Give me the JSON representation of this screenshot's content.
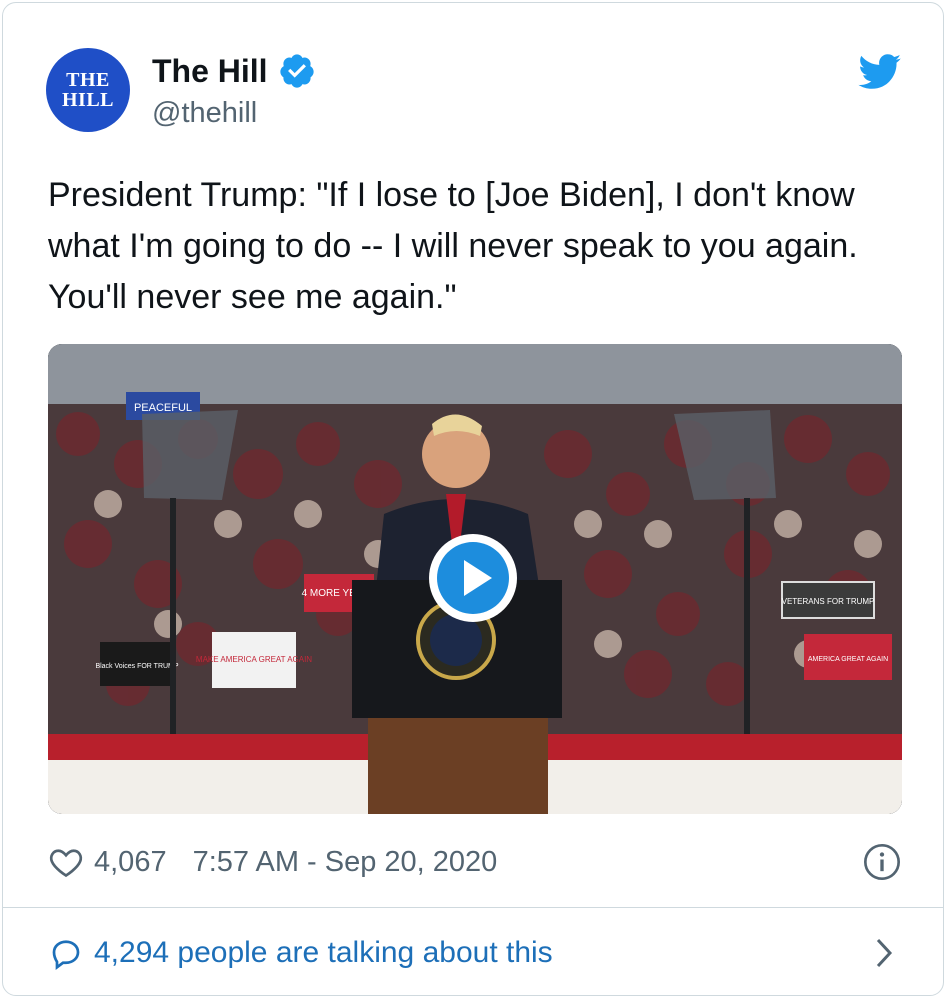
{
  "account": {
    "avatar_text_line1": "THE",
    "avatar_text_line2": "HILL",
    "display_name": "The Hill",
    "handle": "@thehill",
    "verified": true,
    "avatar_color": "#1f4fc7"
  },
  "tweet": {
    "text": "President Trump: \"If I lose to [Joe Biden], I don't know what I'm going to do -- I will never speak to you again. You'll never see me again.\"",
    "likes": "4,067",
    "timestamp": "7:57 AM - Sep 20, 2020"
  },
  "media": {
    "type": "video",
    "play_icon": "play-icon",
    "signs": [
      "PEACEFUL",
      "4 MORE YEARS",
      "MAKE AMERICA GREAT AGAIN",
      "Black Voices FOR TRUMP",
      "VETERANS FOR TRUMP",
      "AMERICA GREAT AGAIN"
    ]
  },
  "footer": {
    "talking_text": "4,294 people are talking about this"
  },
  "colors": {
    "twitter_blue": "#1d9bf0",
    "link_blue": "#1d6fb8",
    "muted": "#536471"
  }
}
